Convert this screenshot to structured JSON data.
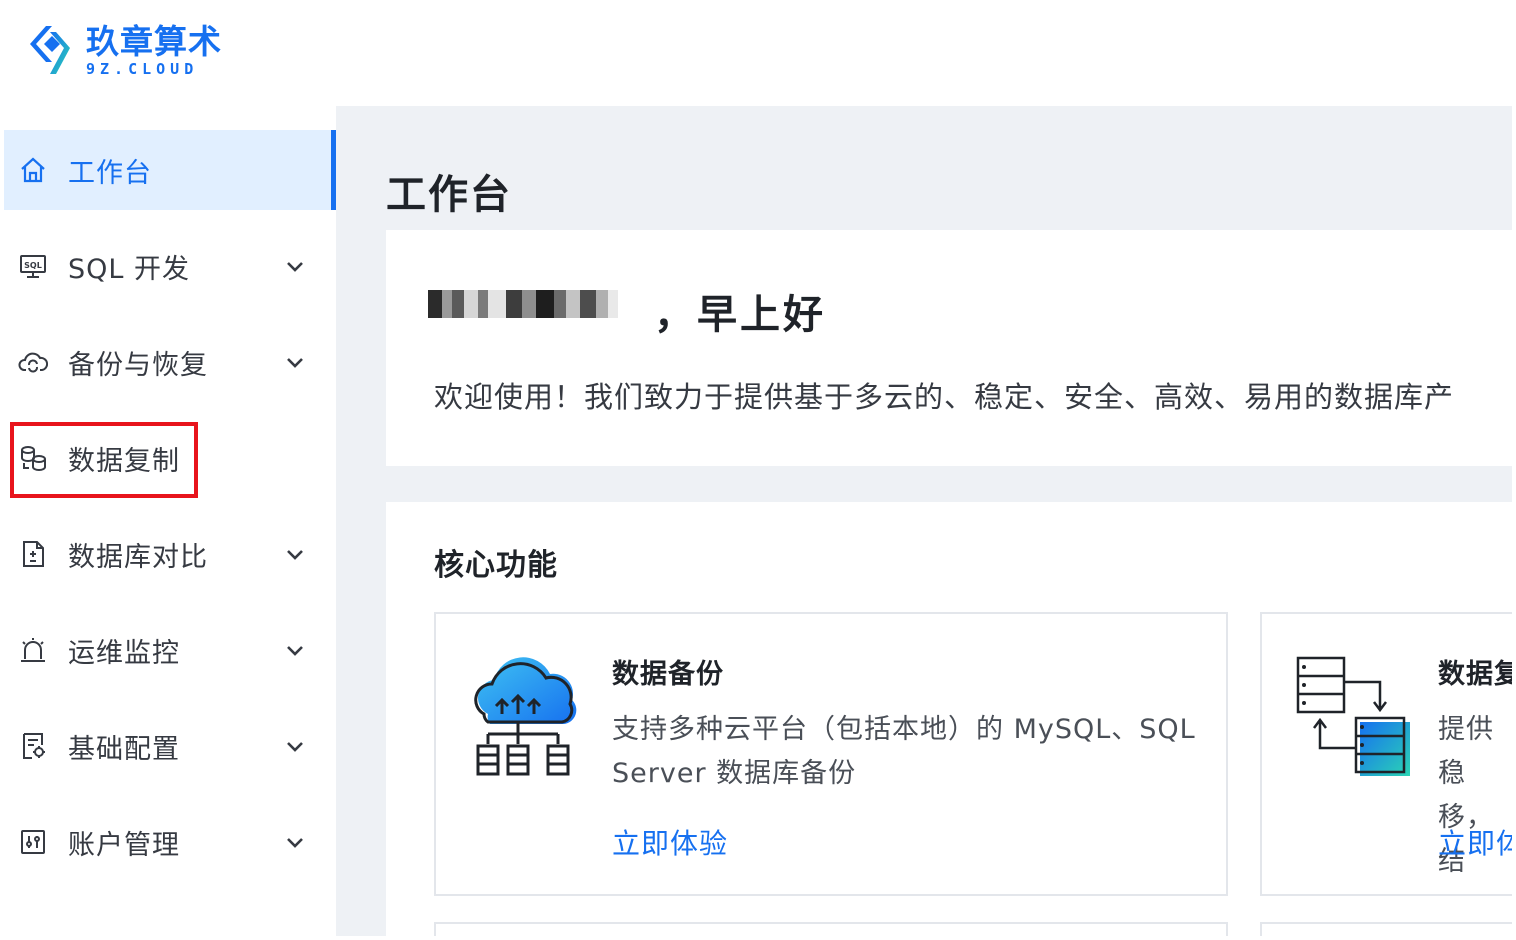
{
  "brand": {
    "name_cn": "玖章算术",
    "name_en": "9Z.CLOUD",
    "color": "#1670f0"
  },
  "sidebar": {
    "items": [
      {
        "label": "工作台",
        "icon": "home-icon",
        "active": true,
        "expandable": false
      },
      {
        "label": "SQL 开发",
        "icon": "sql-monitor-icon",
        "active": false,
        "expandable": true
      },
      {
        "label": "备份与恢复",
        "icon": "cloud-sync-icon",
        "active": false,
        "expandable": true
      },
      {
        "label": "数据复制",
        "icon": "database-replicate-icon",
        "active": false,
        "expandable": false,
        "highlighted": true
      },
      {
        "label": "数据库对比",
        "icon": "document-compare-icon",
        "active": false,
        "expandable": true
      },
      {
        "label": "运维监控",
        "icon": "alarm-icon",
        "active": false,
        "expandable": true
      },
      {
        "label": "基础配置",
        "icon": "config-document-icon",
        "active": false,
        "expandable": true
      },
      {
        "label": "账户管理",
        "icon": "account-settings-icon",
        "active": false,
        "expandable": true
      }
    ]
  },
  "main": {
    "page_title": "工作台",
    "welcome": {
      "greeting": "，早上好",
      "text": "欢迎使用！我们致力于提供基于多云的、稳定、安全、高效、易用的数据库产"
    },
    "core": {
      "title": "核心功能",
      "features": [
        {
          "title": "数据备份",
          "desc": "支持多种云平台（包括本地）的 MySQL、SQL Server 数据库备份",
          "link": "立即体验",
          "icon": "cloud-backup-icon"
        },
        {
          "title": "数据复",
          "desc": "提供稳 移，结",
          "link": "立即体",
          "icon": "data-replication-icon"
        }
      ]
    }
  },
  "colors": {
    "accent": "#1670f0",
    "active_bg": "#e1efff",
    "highlight": "#e8141c",
    "page_bg": "#eef1f5"
  }
}
